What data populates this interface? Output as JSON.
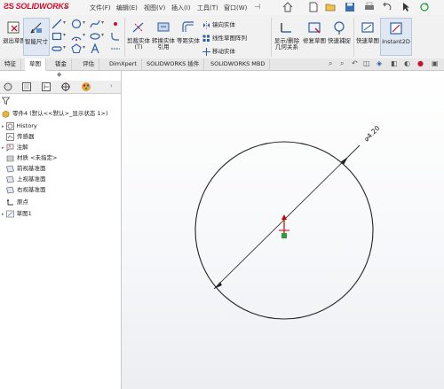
{
  "app": {
    "logo_text": "SOLIDWORKS"
  },
  "menu": {
    "items": [
      "文件(F)",
      "编辑(E)",
      "视图(V)",
      "插入(I)",
      "工具(T)",
      "窗口(W)"
    ]
  },
  "ribbon": {
    "exit_sketch": "退出草图",
    "smart_dimension": "智能尺寸",
    "cut_entities": "剪裁实体(T)",
    "convert_entities": "转换实体引用",
    "offset_entities": "等距实体",
    "mirror_entities": "镜向实体",
    "linear_pattern": "线性草图阵列",
    "move_entities": "移动实体",
    "display_relations": "显示/删除几何关系",
    "repair_sketch": "修复草图",
    "quick_snaps": "快速捕捉",
    "rapid_sketch": "快速草图",
    "instant2d": "Instant2D"
  },
  "tabs": [
    "特征",
    "草图",
    "钣金",
    "评估",
    "DimXpert",
    "SOLIDWORKS 插件",
    "SOLIDWORKS MBD"
  ],
  "tree": {
    "root": "零件4 (默认<<默认>_显示状态 1>)",
    "items": [
      "History",
      "传感器",
      "注解",
      "材质 <未指定>",
      "前视基准面",
      "上视基准面",
      "右视基准面",
      "原点",
      "草图1"
    ]
  },
  "sketch": {
    "dimension_label": "⌀4.20"
  },
  "colors": {
    "accent": "#c8102e",
    "origin_red": "#d00000",
    "selection_green": "#2a9d3a"
  }
}
